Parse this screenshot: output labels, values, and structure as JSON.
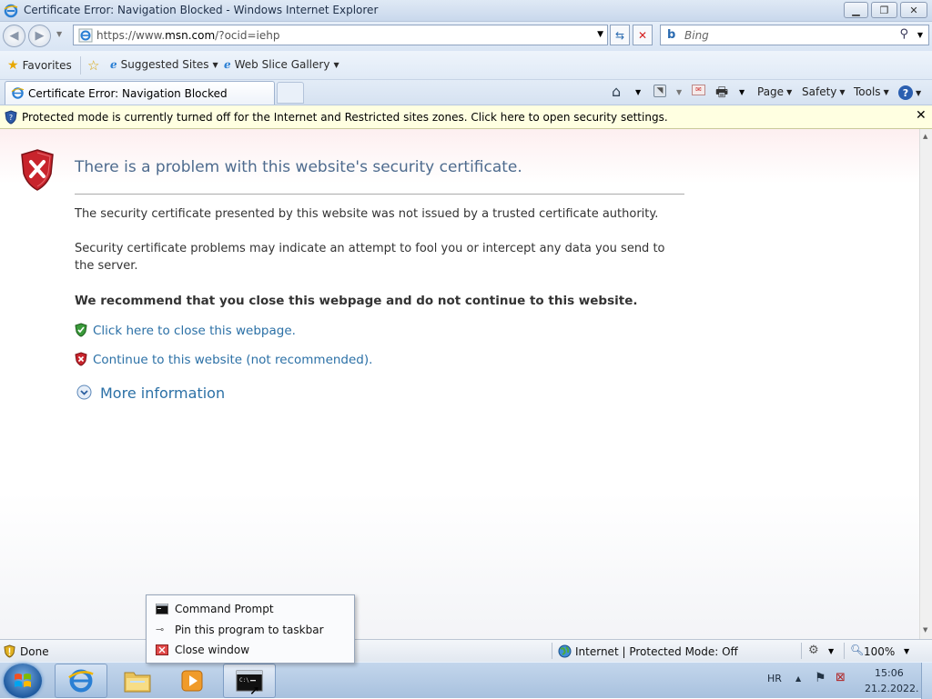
{
  "window": {
    "title": "Certificate Error: Navigation Blocked - Windows Internet Explorer"
  },
  "address": {
    "url_prefix": "https://www.",
    "url_domain": "msn.com",
    "url_suffix": "/?ocid=iehp"
  },
  "search": {
    "placeholder": "Bing"
  },
  "favorites": {
    "label": "Favorites",
    "items": [
      "Suggested Sites",
      "Web Slice Gallery"
    ]
  },
  "tab": {
    "title": "Certificate Error: Navigation Blocked"
  },
  "commandbar": {
    "page": "Page",
    "safety": "Safety",
    "tools": "Tools"
  },
  "infobar": {
    "message": "Protected mode is currently turned off for the Internet and Restricted sites zones.  Click here to open security settings."
  },
  "page": {
    "heading": "There is a problem with this website's security certificate.",
    "p1": "The security certificate presented by this website was not issued by a trusted certificate authority.",
    "p2": "Security certificate problems may indicate an attempt to fool you or intercept any data you send to the server.",
    "recommend": "We recommend that you close this webpage and do not continue to this website.",
    "close_link": "Click here to close this webpage.",
    "continue_link": "Continue to this website (not recommended).",
    "more_info": "More information"
  },
  "status": {
    "left": "Done",
    "zone": "Internet | Protected Mode: Off",
    "zoom": "100%"
  },
  "jumplist": {
    "items": [
      "Command Prompt",
      "Pin this program to taskbar",
      "Close window"
    ]
  },
  "tray": {
    "lang": "HR",
    "time": "15:06",
    "date": "21.2.2022."
  },
  "colors": {
    "link": "#2b70a6",
    "heading": "#4e6b8e",
    "infobar": "#ffffe1"
  }
}
